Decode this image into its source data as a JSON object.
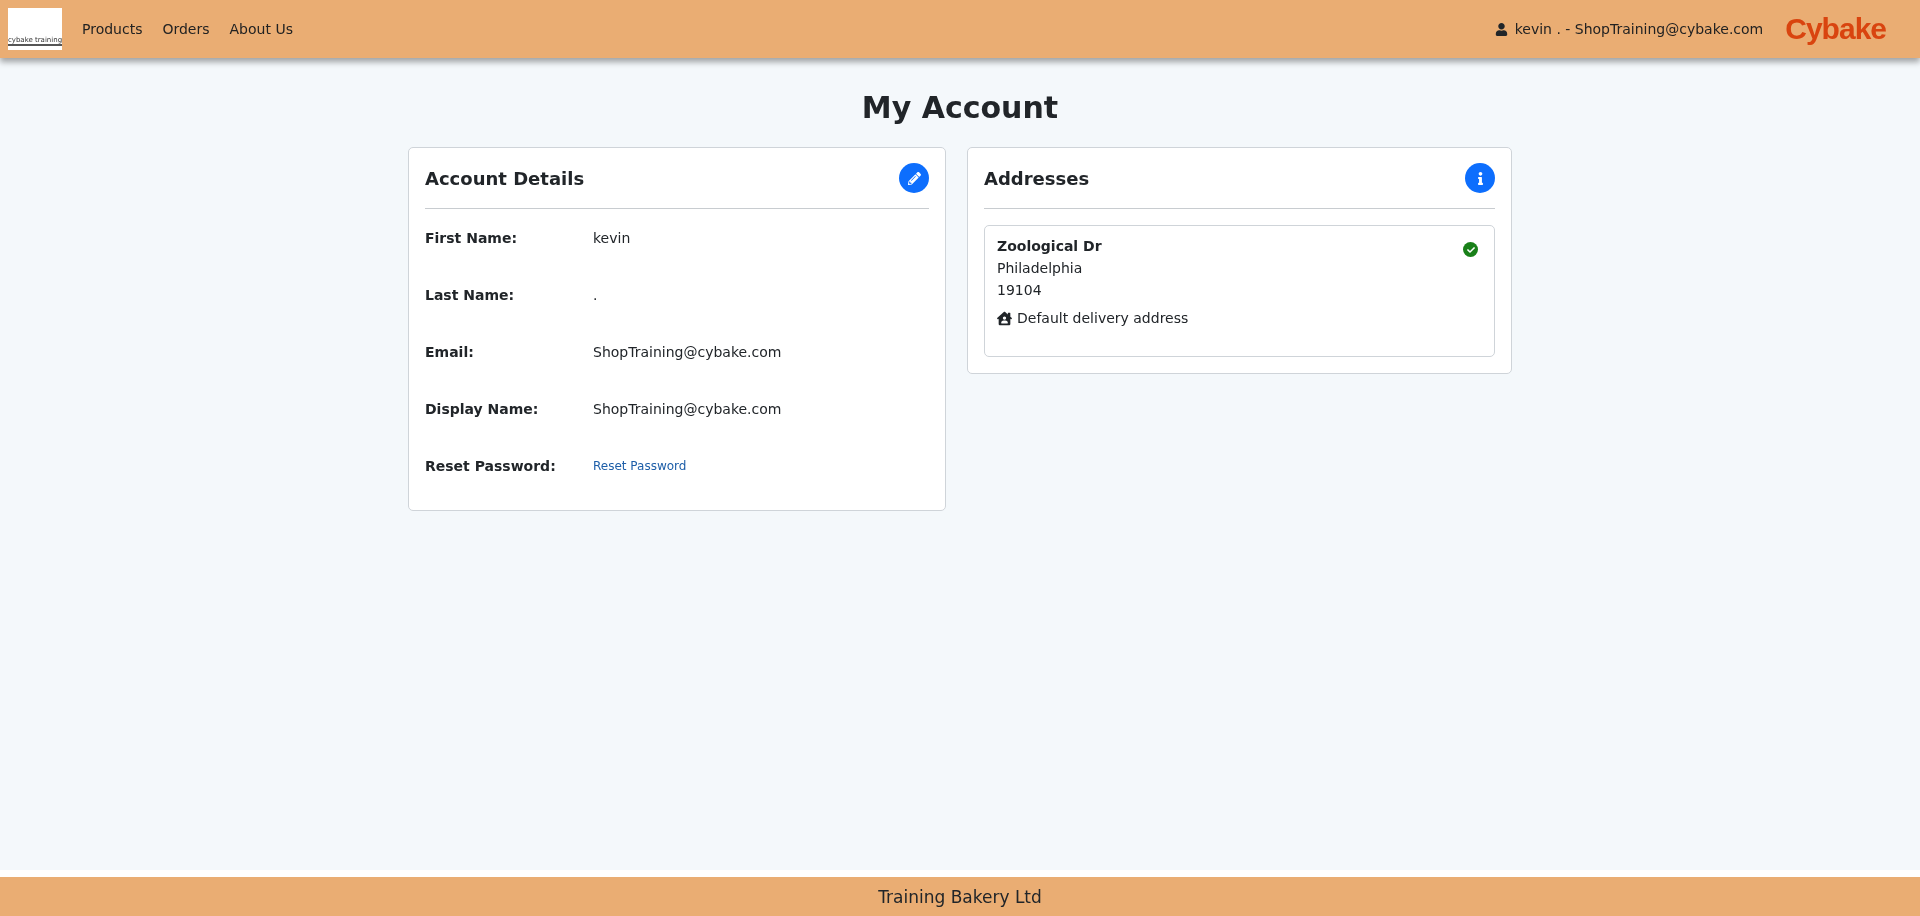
{
  "navbar": {
    "logo_text": "cybake training",
    "links": [
      {
        "label": "Products"
      },
      {
        "label": "Orders"
      },
      {
        "label": "About Us"
      }
    ],
    "user": "kevin . - ShopTraining@cybake.com",
    "brand": "Cybake"
  },
  "page_title": "My Account",
  "account_details": {
    "title": "Account Details",
    "fields": [
      {
        "label": "First Name:",
        "value": "kevin",
        "kind": "text"
      },
      {
        "label": "Last Name:",
        "value": ".",
        "kind": "text"
      },
      {
        "label": "Email:",
        "value": "ShopTraining@cybake.com",
        "kind": "text"
      },
      {
        "label": "Display Name:",
        "value": "ShopTraining@cybake.com",
        "kind": "text"
      },
      {
        "label": "Reset Password:",
        "value": "Reset Password",
        "kind": "link"
      }
    ]
  },
  "addresses": {
    "title": "Addresses",
    "items": [
      {
        "street": "Zoological Dr",
        "city": "Philadelphia",
        "postcode": "19104",
        "note": "Default delivery address",
        "checked": true
      }
    ]
  },
  "footer": "Training Bakery Ltd"
}
